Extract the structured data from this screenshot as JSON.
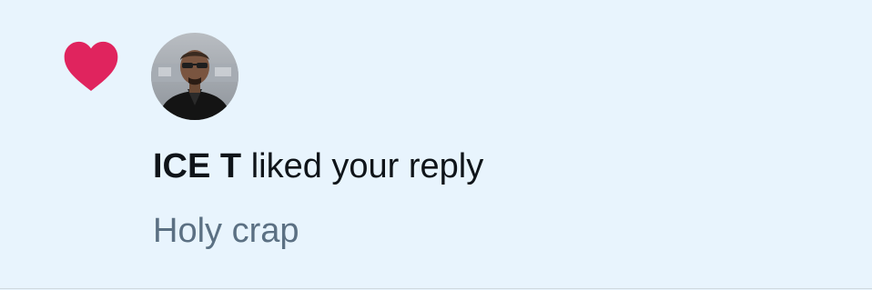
{
  "notification": {
    "type": "like",
    "icon": "heart-icon",
    "accent_color": "#e0245e",
    "background_color": "#e8f4fd",
    "user": {
      "name": "ICE T",
      "avatar": "profile-photo"
    },
    "action_text": "liked your reply",
    "reply_snippet": "Holy crap"
  }
}
